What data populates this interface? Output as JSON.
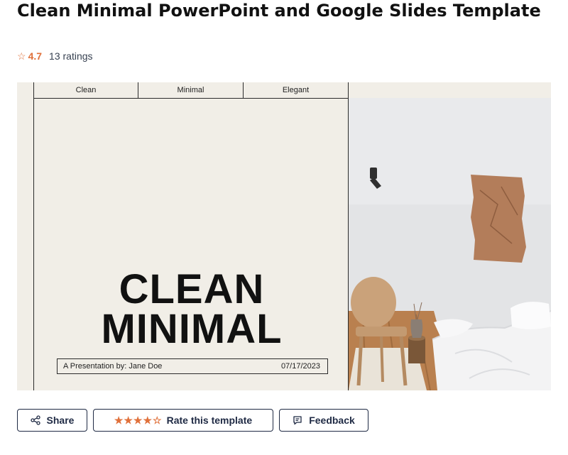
{
  "template": {
    "title": "Clean Minimal PowerPoint and Google Slides Template",
    "rating": {
      "score": "4.7",
      "count_text": "13 ratings",
      "value": 4.7,
      "max": 5
    }
  },
  "slide": {
    "tags": [
      "Clean",
      "Minimal",
      "Elegant"
    ],
    "headline_line1": "CLEAN",
    "headline_line2": "MINIMAL",
    "presenter": "A Presentation by: Jane Doe",
    "date": "07/17/2023"
  },
  "actions": {
    "share_label": "Share",
    "rate_label": "Rate this template",
    "feedback_label": "Feedback"
  },
  "colors": {
    "accent": "#e0703a",
    "button_border": "#1f2a44",
    "slide_bg": "#f1eee7"
  },
  "icons": {
    "rating": "star-icon",
    "share": "share-icon",
    "rate": "star-icon",
    "feedback": "message-icon"
  }
}
